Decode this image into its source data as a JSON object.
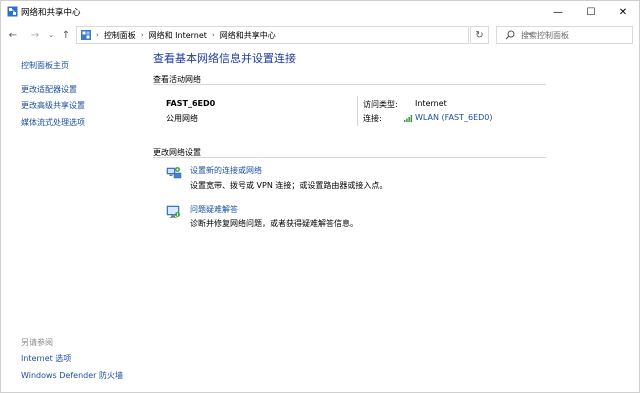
{
  "window": {
    "title": "网络和共享中心",
    "minimize_glyph": "—",
    "maximize_glyph": "☐",
    "close_glyph": "✕"
  },
  "navigation": {
    "back_glyph": "←",
    "forward_glyph": "→",
    "recent_glyph": "⌄",
    "up_glyph": "↑",
    "refresh_glyph": "↻",
    "dropdown_glyph": "⌄",
    "breadcrumbs": [
      "控制面板",
      "网络和 Internet",
      "网络和共享中心"
    ],
    "separator": "›"
  },
  "search": {
    "placeholder": "搜索控制面板"
  },
  "sidebar": {
    "items": [
      {
        "label": "控制面板主页"
      },
      {
        "label": "更改适配器设置"
      },
      {
        "label": "更改高级共享设置"
      },
      {
        "label": "媒体流式处理选项"
      }
    ],
    "see_also_title": "另请参阅",
    "see_also": [
      {
        "label": "Internet 选项"
      },
      {
        "label": "Windows Defender 防火墙"
      }
    ]
  },
  "main": {
    "title": "查看基本网络信息并设置连接",
    "active_networks_label": "查看活动网络",
    "network": {
      "name": "FAST_6ED0",
      "type": "公用网络",
      "access_type_label": "访问类型:",
      "access_type_value": "Internet",
      "connection_label": "连接:",
      "connection_value": "WLAN (FAST_6ED0)"
    },
    "change_settings_label": "更改网络设置",
    "tasks": [
      {
        "icon": "network-setup-icon",
        "link": "设置新的连接或网络",
        "desc": "设置宽带、拨号或 VPN 连接；或设置路由器或接入点。"
      },
      {
        "icon": "troubleshoot-icon",
        "link": "问题疑难解答",
        "desc": "诊断并修复网络问题，或者获得疑难解答信息。"
      }
    ]
  },
  "colors": {
    "link": "#1a4fa0",
    "title": "#1e3b9c",
    "muted": "#8a8a8a",
    "divider": "#d6d6d6"
  }
}
